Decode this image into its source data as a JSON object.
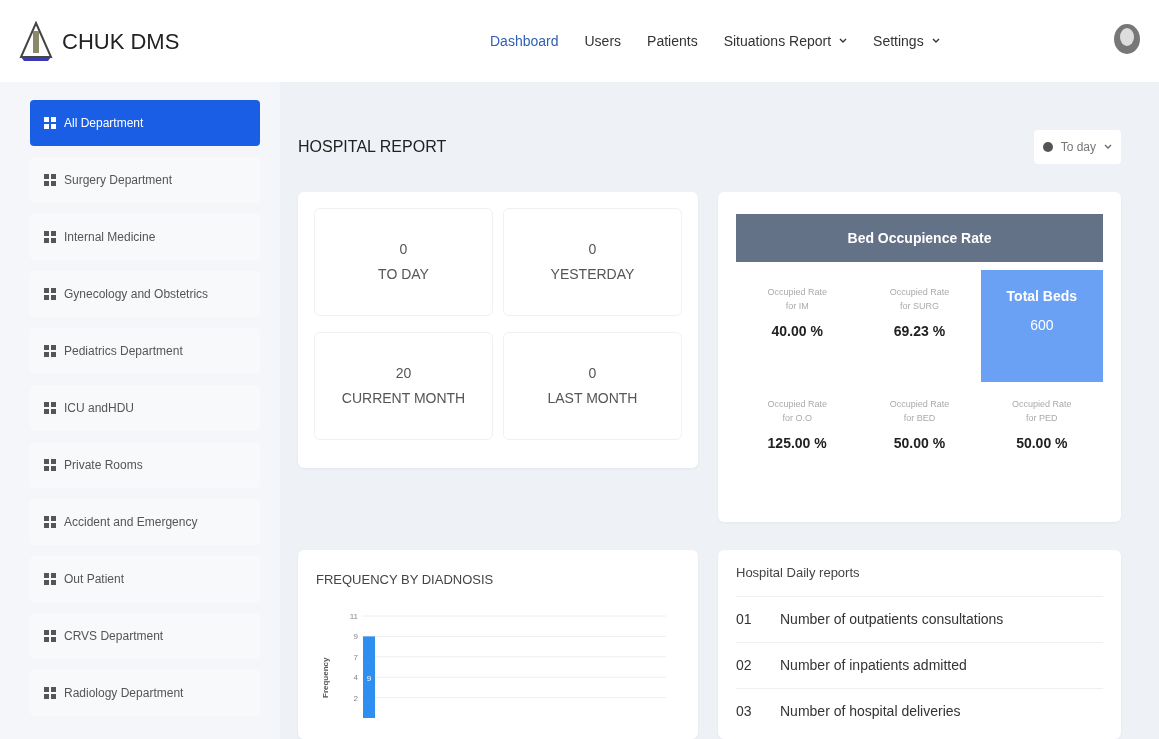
{
  "brand": {
    "name": "CHUK DMS"
  },
  "nav": [
    {
      "label": "Dashboard",
      "selected": true,
      "dropdown": false
    },
    {
      "label": "Users",
      "selected": false,
      "dropdown": false
    },
    {
      "label": "Patients",
      "selected": false,
      "dropdown": false
    },
    {
      "label": "Situations Report",
      "selected": false,
      "dropdown": true
    },
    {
      "label": "Settings",
      "selected": false,
      "dropdown": true
    }
  ],
  "sidebar": {
    "items": [
      {
        "label": "All Department",
        "selected": true
      },
      {
        "label": "Surgery Department",
        "selected": false
      },
      {
        "label": "Internal Medicine",
        "selected": false
      },
      {
        "label": "Gynecology and Obstetrics",
        "selected": false
      },
      {
        "label": "Pediatrics Department",
        "selected": false
      },
      {
        "label": "ICU andHDU",
        "selected": false
      },
      {
        "label": "Private Rooms",
        "selected": false
      },
      {
        "label": "Accident and Emergency",
        "selected": false
      },
      {
        "label": "Out Patient",
        "selected": false
      },
      {
        "label": "CRVS Department",
        "selected": false
      },
      {
        "label": "Radiology Department",
        "selected": false
      }
    ]
  },
  "report": {
    "title": "HOSPITAL REPORT",
    "period": "To day"
  },
  "stats": [
    {
      "value": "0",
      "label": "TO DAY"
    },
    {
      "value": "0",
      "label": "YESTERDAY"
    },
    {
      "value": "20",
      "label": "CURRENT MONTH"
    },
    {
      "value": "0",
      "label": "LAST MONTH"
    }
  ],
  "bed": {
    "title": "Bed Occupience Rate",
    "cells": [
      {
        "kind": "rate",
        "label": "Occupied Rate for IM",
        "value": "40.00 %"
      },
      {
        "kind": "rate",
        "label": "Occupied Rate for SURG",
        "value": "69.23 %"
      },
      {
        "kind": "total",
        "label": "Total Beds",
        "value": "600"
      },
      {
        "kind": "rate",
        "label": "Occupied Rate for O.O",
        "value": "125.00 %"
      },
      {
        "kind": "rate",
        "label": "Occupied Rate for BED",
        "value": "50.00 %"
      },
      {
        "kind": "rate",
        "label": "Occupied Rate for PED",
        "value": "50.00 %"
      }
    ]
  },
  "frequency": {
    "title": "FREQUENCY BY DIADNOSIS",
    "chart_data": {
      "type": "bar",
      "ylabel": "Frequency",
      "values": [
        9
      ],
      "data_labels": true,
      "grid": true,
      "ylim": [
        0,
        11.25
      ],
      "yticks": [
        {
          "value": 11.25,
          "label": "11"
        },
        {
          "value": 9,
          "label": "9"
        },
        {
          "value": 6.75,
          "label": "7"
        },
        {
          "value": 4.5,
          "label": "4"
        },
        {
          "value": 2.25,
          "label": "2"
        }
      ]
    }
  },
  "daily": {
    "title": "Hospital Daily reports",
    "rows": [
      {
        "number": "01",
        "text": "Number of outpatients consultations"
      },
      {
        "number": "02",
        "text": "Number of inpatients admitted"
      },
      {
        "number": "03",
        "text": "Number of hospital deliveries"
      }
    ]
  }
}
